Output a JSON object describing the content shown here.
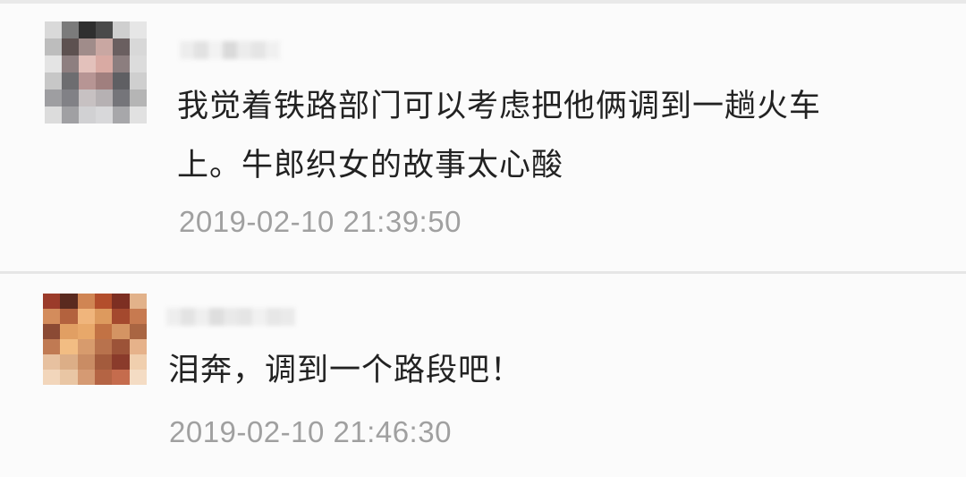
{
  "comments": [
    {
      "text": "我觉着铁路部门可以考虑把他俩调到一趟火车上。牛郎织女的故事太心酸",
      "timestamp": "2019-02-10 21:39:50",
      "avatar_colors": [
        "#d9d9d9",
        "#7b7b7b",
        "#2f2f2f",
        "#4a4a4a",
        "#cfcfcf",
        "#e6e6e6",
        "#bdbdbd",
        "#5d5150",
        "#a08c8a",
        "#c9a7a2",
        "#6a5f60",
        "#d8d8d8",
        "#e4e4e4",
        "#8e7f80",
        "#e3c1bb",
        "#d9aaa3",
        "#8c7e7f",
        "#dcdcdc",
        "#c7c7c7",
        "#6d6d70",
        "#b79594",
        "#a07f7e",
        "#5f5f63",
        "#cfcfcf",
        "#9e9ea1",
        "#818186",
        "#c7c1c2",
        "#b6b1b3",
        "#75757a",
        "#b5b5b5",
        "#dcdcdc",
        "#a0a0a3",
        "#d1d1d3",
        "#d8d8da",
        "#a7a7aa",
        "#e1e1e1"
      ],
      "username_colors": [
        "#ededed",
        "#e2e2e2",
        "#f2f2f2",
        "#dadada",
        "#ececec",
        "#e5e5e5",
        "#f0f0f0"
      ]
    },
    {
      "text": "泪奔，调到一个路段吧！",
      "timestamp": "2019-02-10 21:46:30",
      "avatar_colors": [
        "#9b3b2a",
        "#5a2a1f",
        "#d08553",
        "#b34e2c",
        "#7d2f22",
        "#e2b28a",
        "#d38c5c",
        "#b3623e",
        "#f0b57c",
        "#dd9a5e",
        "#a4492e",
        "#c77a50",
        "#8b4a34",
        "#e19f63",
        "#e8a86a",
        "#c27244",
        "#d49463",
        "#a96542",
        "#c07a53",
        "#f2bd83",
        "#d79b6d",
        "#b8724d",
        "#9c5338",
        "#e6b28a",
        "#e7c1a0",
        "#dcae87",
        "#c98c64",
        "#a35b3d",
        "#8a3b2b",
        "#f0cfae",
        "#f2d6bb",
        "#e9c6a4",
        "#d59a73",
        "#b46444",
        "#c56c4d",
        "#f4dcc4"
      ],
      "username_colors": [
        "#eeeeee",
        "#e3e3e3",
        "#efefef",
        "#dedede",
        "#e9e9e9",
        "#e5e5e5",
        "#f1f1f1",
        "#e7e7e7",
        "#eaeaea"
      ]
    }
  ]
}
